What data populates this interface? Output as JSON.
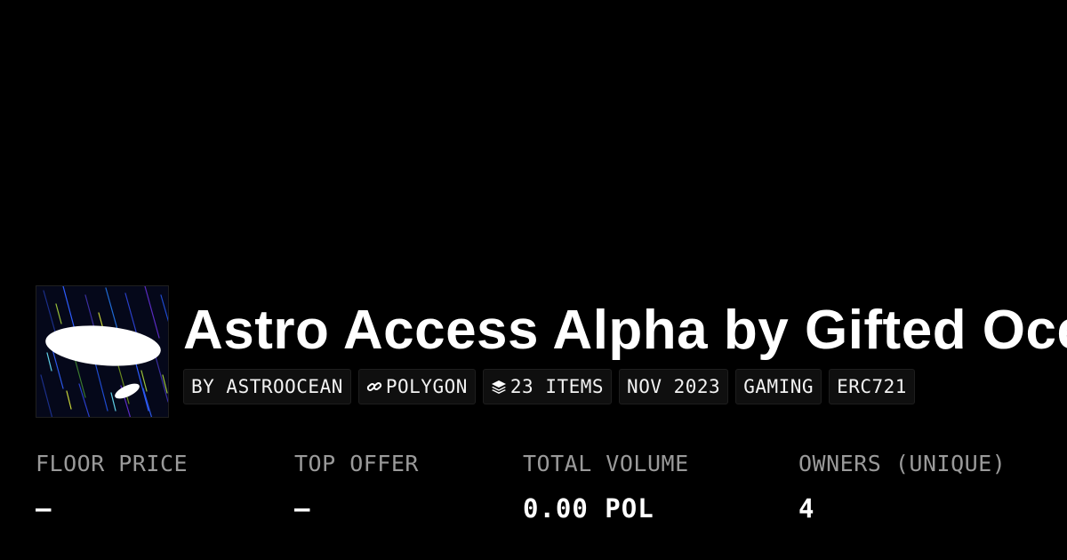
{
  "collection": {
    "title": "Astro Access Alpha by Gifted Oce",
    "avatar_icon": "collection-artwork-icon"
  },
  "tags": {
    "creator": "BY ASTROOCEAN",
    "chain": "POLYGON",
    "chain_icon": "link-icon",
    "items": "23 ITEMS",
    "items_icon": "layers-icon",
    "date": "NOV 2023",
    "category": "GAMING",
    "standard": "ERC721"
  },
  "stats": {
    "floor_price": {
      "label": "FLOOR PRICE",
      "value": "–"
    },
    "top_offer": {
      "label": "TOP OFFER",
      "value": "–"
    },
    "total_volume": {
      "label": "TOTAL VOLUME",
      "value": "0.00 POL"
    },
    "owners": {
      "label": "OWNERS (UNIQUE)",
      "value": "4"
    }
  },
  "colors": {
    "background": "#000000",
    "text": "#ffffff",
    "muted": "#9a9a9a",
    "tag_bg": "#0f0f0f"
  }
}
